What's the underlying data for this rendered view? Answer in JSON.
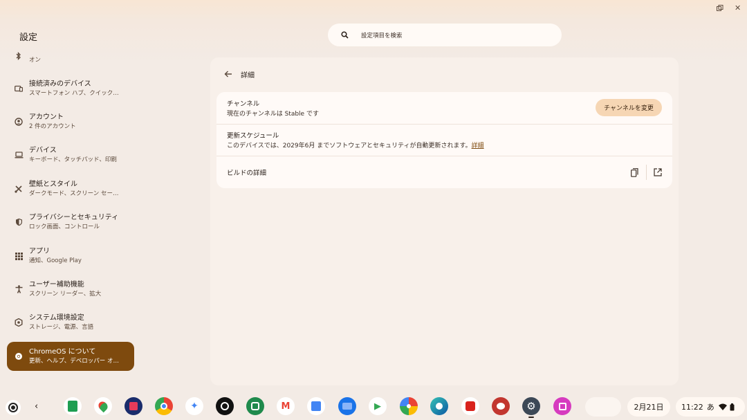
{
  "window": {
    "title": "設定"
  },
  "search": {
    "placeholder": "設定項目を検索"
  },
  "sidebar": {
    "items": [
      {
        "name": "bluetooth",
        "title": "",
        "subtitle": "オン"
      },
      {
        "name": "connected-devices",
        "title": "接続済みのデバイス",
        "subtitle": "スマートフォン ハブ、クイック…"
      },
      {
        "name": "accounts",
        "title": "アカウント",
        "subtitle": "2 件のアカウント"
      },
      {
        "name": "device",
        "title": "デバイス",
        "subtitle": "キーボード、タッチパッド、印刷"
      },
      {
        "name": "wallpaper-style",
        "title": "壁紙とスタイル",
        "subtitle": "ダークモード、スクリーン セー…"
      },
      {
        "name": "privacy-security",
        "title": "プライバシーとセキュリティ",
        "subtitle": "ロック画面、コントロール"
      },
      {
        "name": "apps",
        "title": "アプリ",
        "subtitle": "通知、Google Play"
      },
      {
        "name": "accessibility",
        "title": "ユーザー補助機能",
        "subtitle": "スクリーン リーダー、拡大"
      },
      {
        "name": "system-preferences",
        "title": "システム環境設定",
        "subtitle": "ストレージ、電源、言語"
      },
      {
        "name": "about-chromeos",
        "title": "ChromeOS について",
        "subtitle": "更新、ヘルプ、デベロッパー オ…"
      }
    ]
  },
  "main": {
    "back_label": "詳細",
    "channel": {
      "title": "チャンネル",
      "subtitle": "現在のチャンネルは Stable です",
      "button": "チャンネルを変更"
    },
    "schedule": {
      "title": "更新スケジュール",
      "subtitle": "このデバイスでは、2029年6月 までソフトウェアとセキュリティが自動更新されます。",
      "link": "詳細"
    },
    "build": {
      "title": "ビルドの詳細"
    }
  },
  "shelf": {
    "apps": [
      "sheets",
      "maps",
      "game",
      "chrome",
      "gemini",
      "podcast",
      "meet",
      "gmail",
      "calendar",
      "files",
      "play-store",
      "photos",
      "edge",
      "red-app",
      "paint",
      "settings",
      "pink-app"
    ],
    "date": "2月21日",
    "time": "11:22",
    "ime": "あ"
  },
  "colors": {
    "accent": "#7e4a0e",
    "button_bg": "#f6d6b4",
    "panel_bg": "#f8f0ea"
  }
}
